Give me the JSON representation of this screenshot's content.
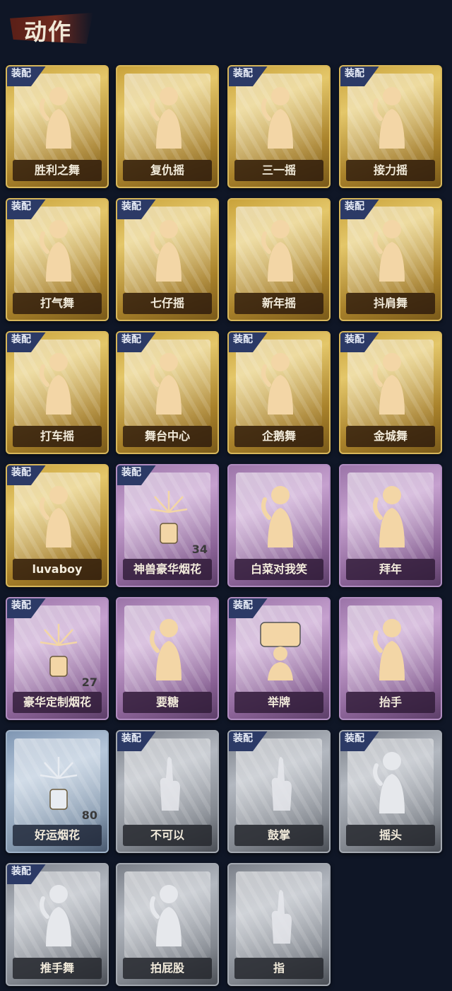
{
  "header": {
    "title": "动作"
  },
  "colors": {
    "gold": "#d8b75a",
    "purple": "#b08cc0",
    "blue": "#9fb2c8",
    "gray": "#a4a9b1",
    "tag": "#2c3a66"
  },
  "equip_label": "装配",
  "cards": [
    {
      "label": "胜利之舞",
      "rarity": "gold",
      "equipped": true,
      "icon": "dance-figure-icon"
    },
    {
      "label": "复仇摇",
      "rarity": "gold",
      "equipped": false,
      "icon": "dance-figure-icon"
    },
    {
      "label": "三一摇",
      "rarity": "gold",
      "equipped": true,
      "icon": "dance-figure-icon"
    },
    {
      "label": "接力摇",
      "rarity": "gold",
      "equipped": true,
      "icon": "dance-figure-icon"
    },
    {
      "label": "打气舞",
      "rarity": "gold",
      "equipped": true,
      "icon": "dance-figure-icon"
    },
    {
      "label": "七仔摇",
      "rarity": "gold",
      "equipped": true,
      "icon": "dance-figure-icon"
    },
    {
      "label": "新年摇",
      "rarity": "gold",
      "equipped": false,
      "icon": "dance-figure-icon"
    },
    {
      "label": "抖肩舞",
      "rarity": "gold",
      "equipped": true,
      "icon": "dance-figure-icon"
    },
    {
      "label": "打车摇",
      "rarity": "gold",
      "equipped": true,
      "icon": "dance-figure-icon"
    },
    {
      "label": "舞台中心",
      "rarity": "gold",
      "equipped": true,
      "icon": "dance-figure-icon"
    },
    {
      "label": "企鹅舞",
      "rarity": "gold",
      "equipped": true,
      "icon": "dance-figure-icon"
    },
    {
      "label": "金城舞",
      "rarity": "gold",
      "equipped": true,
      "icon": "dance-figure-icon"
    },
    {
      "label": "luvaboy",
      "rarity": "gold",
      "equipped": true,
      "icon": "dance-figure-icon"
    },
    {
      "label": "神兽豪华烟花",
      "rarity": "purple",
      "equipped": true,
      "icon": "firework-icon",
      "count": "34"
    },
    {
      "label": "白菜对我笑",
      "rarity": "purple",
      "equipped": false,
      "icon": "dance-figure-icon"
    },
    {
      "label": "拜年",
      "rarity": "purple",
      "equipped": false,
      "icon": "greeting-figure-icon"
    },
    {
      "label": "豪华定制烟花",
      "rarity": "purple",
      "equipped": true,
      "icon": "firework-icon",
      "count": "27"
    },
    {
      "label": "要糖",
      "rarity": "purple",
      "equipped": false,
      "icon": "figure-icon"
    },
    {
      "label": "举牌",
      "rarity": "purple",
      "equipped": true,
      "icon": "sign-figure-icon"
    },
    {
      "label": "抬手",
      "rarity": "purple",
      "equipped": false,
      "icon": "figure-icon"
    },
    {
      "label": "好运烟花",
      "rarity": "blue",
      "equipped": false,
      "icon": "firework-icon",
      "count": "80"
    },
    {
      "label": "不可以",
      "rarity": "gray",
      "equipped": true,
      "icon": "finger-icon"
    },
    {
      "label": "鼓掌",
      "rarity": "gray",
      "equipped": true,
      "icon": "clap-icon"
    },
    {
      "label": "摇头",
      "rarity": "gray",
      "equipped": true,
      "icon": "figure-icon"
    },
    {
      "label": "推手舞",
      "rarity": "gray",
      "equipped": true,
      "icon": "figure-icon"
    },
    {
      "label": "拍屁股",
      "rarity": "gray",
      "equipped": false,
      "icon": "figure-icon"
    },
    {
      "label": "指",
      "rarity": "gray",
      "equipped": false,
      "icon": "point-icon"
    }
  ]
}
